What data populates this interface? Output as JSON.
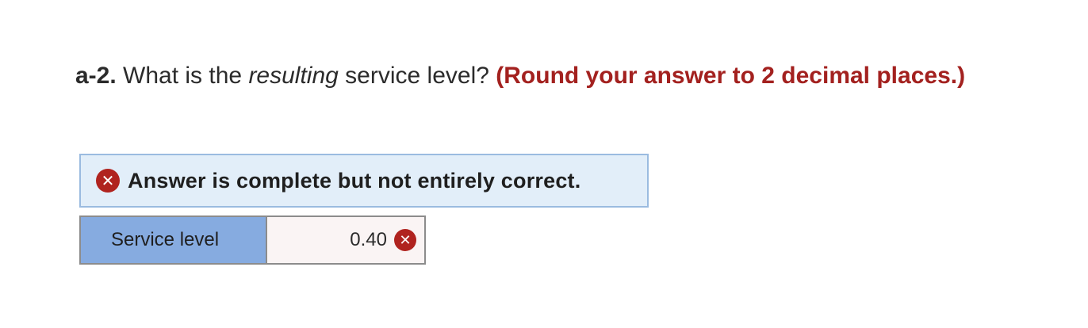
{
  "question": {
    "number": "a-2.",
    "text_before": " What is the ",
    "italic": "resulting",
    "text_after": " service level? ",
    "hint": "(Round your answer to 2 decimal places.)"
  },
  "feedback": {
    "icon": "x-circle-icon",
    "message": "Answer is complete but not entirely correct."
  },
  "answer_table": {
    "label": "Service level",
    "value": "0.40",
    "status_icon": "x-circle-icon"
  },
  "colors": {
    "hint_red": "#a3211f",
    "error_badge": "#b0231f",
    "feedback_bg": "#e2eef9",
    "label_cell_bg": "#86abe0",
    "value_cell_bg": "#faf4f4"
  }
}
